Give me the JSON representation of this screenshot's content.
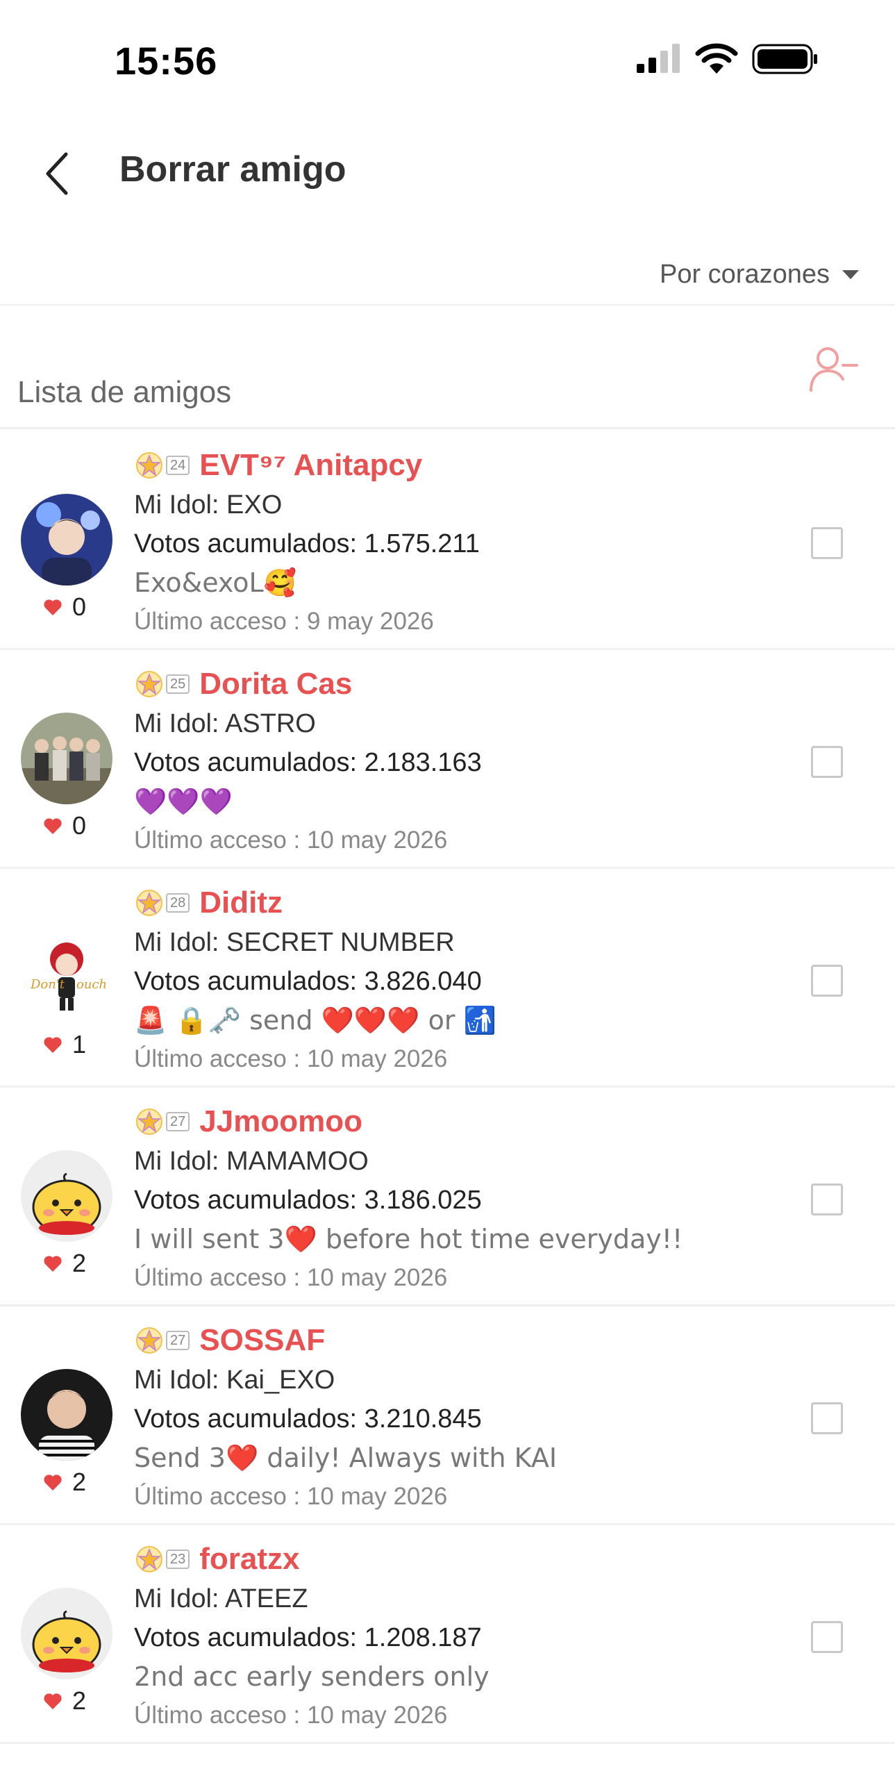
{
  "status_bar": {
    "time": "15:56"
  },
  "nav": {
    "title": "Borrar amigo"
  },
  "sort": {
    "label": "Por corazones"
  },
  "section": {
    "title": "Lista de amigos"
  },
  "colors": {
    "accent": "#e85151",
    "icon_pink": "#f0a0a0"
  },
  "friends": [
    {
      "level": "24",
      "name": "EVT⁹⁷ Anitapcy",
      "idol": "Mi Idol: EXO",
      "votes": "Votos acumulados: 1.575.211",
      "message": "Exo&exoL🥰",
      "last_access": "Último acceso : 9 may 2026",
      "hearts": "0",
      "avatar": "photo-blue"
    },
    {
      "level": "25",
      "name": "Dorita Cas",
      "idol": "Mi Idol: ASTRO",
      "votes": "Votos acumulados: 2.183.163",
      "message": "💜💜💜",
      "last_access": "Último acceso : 10 may 2026",
      "hearts": "0",
      "avatar": "photo-group"
    },
    {
      "level": "28",
      "name": "Diditz",
      "idol": "Mi Idol: SECRET NUMBER",
      "votes": "Votos acumulados: 3.826.040",
      "message": "🚨 🔒🗝️ send ❤️❤️❤️ or 🚮",
      "last_access": "Último acceso : 10 may 2026",
      "hearts": "1",
      "avatar": "doll"
    },
    {
      "level": "27",
      "name": "JJmoomoo",
      "idol": "Mi Idol: MAMAMOO",
      "votes": "Votos acumulados: 3.186.025",
      "message": "I will sent 3❤️ before hot time everyday!!",
      "last_access": "Último acceso : 10 may 2026",
      "hearts": "2",
      "avatar": "chick"
    },
    {
      "level": "27",
      "name": "SOSSAF",
      "idol": "Mi Idol: Kai_EXO",
      "votes": "Votos acumulados: 3.210.845",
      "message": "Send 3❤️ daily! Always with KAI",
      "last_access": "Último acceso : 10 may 2026",
      "hearts": "2",
      "avatar": "photo-dark"
    },
    {
      "level": "23",
      "name": "foratzx",
      "idol": "Mi Idol: ATEEZ",
      "votes": "Votos acumulados: 1.208.187",
      "message": "2nd acc early senders only",
      "last_access": "Último acceso : 10 may 2026",
      "hearts": "2",
      "avatar": "chick"
    }
  ]
}
